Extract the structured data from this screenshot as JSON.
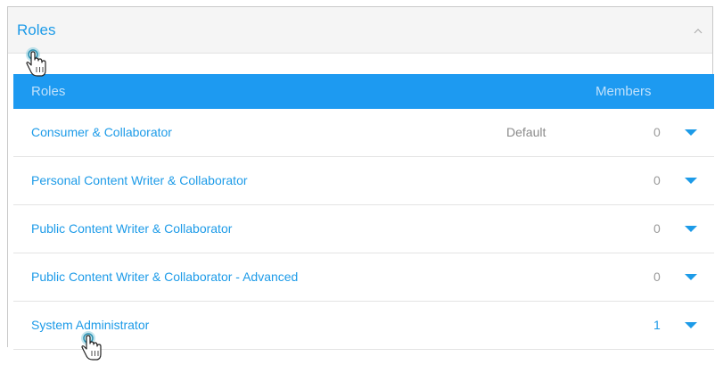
{
  "panel": {
    "title": "Roles",
    "collapse_icon": "chevron-up-icon"
  },
  "table": {
    "columns": {
      "roles": "Roles",
      "members": "Members"
    },
    "rows": [
      {
        "name": "Consumer & Collaborator",
        "default_label": "Default",
        "members": "0"
      },
      {
        "name": "Personal Content Writer & Collaborator",
        "default_label": "",
        "members": "0"
      },
      {
        "name": "Public Content Writer & Collaborator",
        "default_label": "",
        "members": "0"
      },
      {
        "name": "Public Content Writer & Collaborator - Advanced",
        "default_label": "",
        "members": "0"
      },
      {
        "name": "System Administrator",
        "default_label": "",
        "members": "1"
      }
    ]
  },
  "colors": {
    "accent": "#1d9be8",
    "header_bar": "#1d9af1"
  },
  "cursors": [
    "hand-pointer-click-icon",
    "hand-pointer-click-icon"
  ]
}
